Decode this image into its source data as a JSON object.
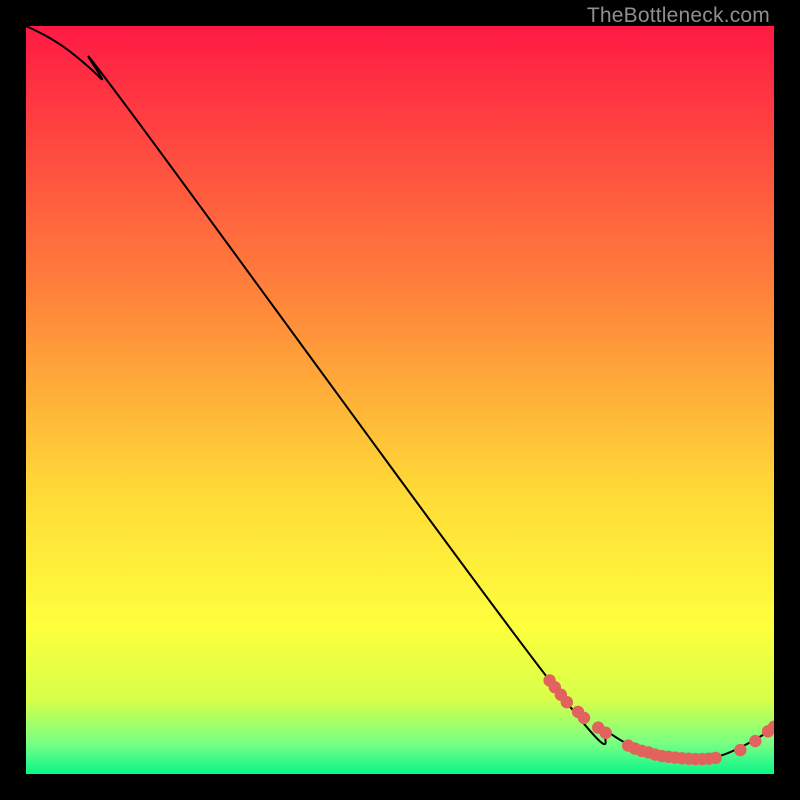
{
  "watermark": "TheBottleneck.com",
  "colors": {
    "dot": "#e2635e",
    "line": "#000000",
    "gradient_top": "#ff1a44",
    "gradient_mid_upper": "#ff833b",
    "gradient_mid": "#ffd937",
    "gradient_mid_lower": "#feff3d",
    "gradient_low1": "#d7ff49",
    "gradient_low2": "#76ff84",
    "gradient_bottom": "#09f58a",
    "frame": "#000000"
  },
  "chart_data": {
    "type": "line",
    "title": "",
    "xlabel": "",
    "ylabel": "",
    "xlim": [
      0,
      100
    ],
    "ylim": [
      0,
      100
    ],
    "curve": [
      {
        "x": 0,
        "y": 100
      },
      {
        "x": 3,
        "y": 98.5
      },
      {
        "x": 6,
        "y": 96.5
      },
      {
        "x": 10,
        "y": 93
      },
      {
        "x": 14,
        "y": 88.5
      },
      {
        "x": 70,
        "y": 12.5
      },
      {
        "x": 78,
        "y": 5.5
      },
      {
        "x": 83,
        "y": 3
      },
      {
        "x": 86,
        "y": 2.2
      },
      {
        "x": 90,
        "y": 2.0
      },
      {
        "x": 93,
        "y": 2.5
      },
      {
        "x": 96,
        "y": 3.8
      },
      {
        "x": 99,
        "y": 5.5
      },
      {
        "x": 100,
        "y": 6.2
      }
    ],
    "scatter_clusters": [
      {
        "x": 70.0,
        "y": 12.5
      },
      {
        "x": 70.7,
        "y": 11.6
      },
      {
        "x": 71.5,
        "y": 10.6
      },
      {
        "x": 72.3,
        "y": 9.6
      },
      {
        "x": 73.8,
        "y": 8.3
      },
      {
        "x": 74.6,
        "y": 7.5
      },
      {
        "x": 76.5,
        "y": 6.2
      },
      {
        "x": 77.5,
        "y": 5.5
      },
      {
        "x": 80.5,
        "y": 3.8
      },
      {
        "x": 81.4,
        "y": 3.4
      },
      {
        "x": 82.3,
        "y": 3.1
      },
      {
        "x": 83.2,
        "y": 2.9
      },
      {
        "x": 84.1,
        "y": 2.6
      },
      {
        "x": 85.0,
        "y": 2.4
      },
      {
        "x": 85.9,
        "y": 2.3
      },
      {
        "x": 86.8,
        "y": 2.2
      },
      {
        "x": 87.7,
        "y": 2.1
      },
      {
        "x": 88.6,
        "y": 2.05
      },
      {
        "x": 89.5,
        "y": 2.0
      },
      {
        "x": 90.4,
        "y": 2.0
      },
      {
        "x": 91.3,
        "y": 2.05
      },
      {
        "x": 92.2,
        "y": 2.15
      },
      {
        "x": 95.5,
        "y": 3.2
      },
      {
        "x": 97.5,
        "y": 4.4
      },
      {
        "x": 99.2,
        "y": 5.7
      },
      {
        "x": 100.0,
        "y": 6.3
      }
    ]
  }
}
